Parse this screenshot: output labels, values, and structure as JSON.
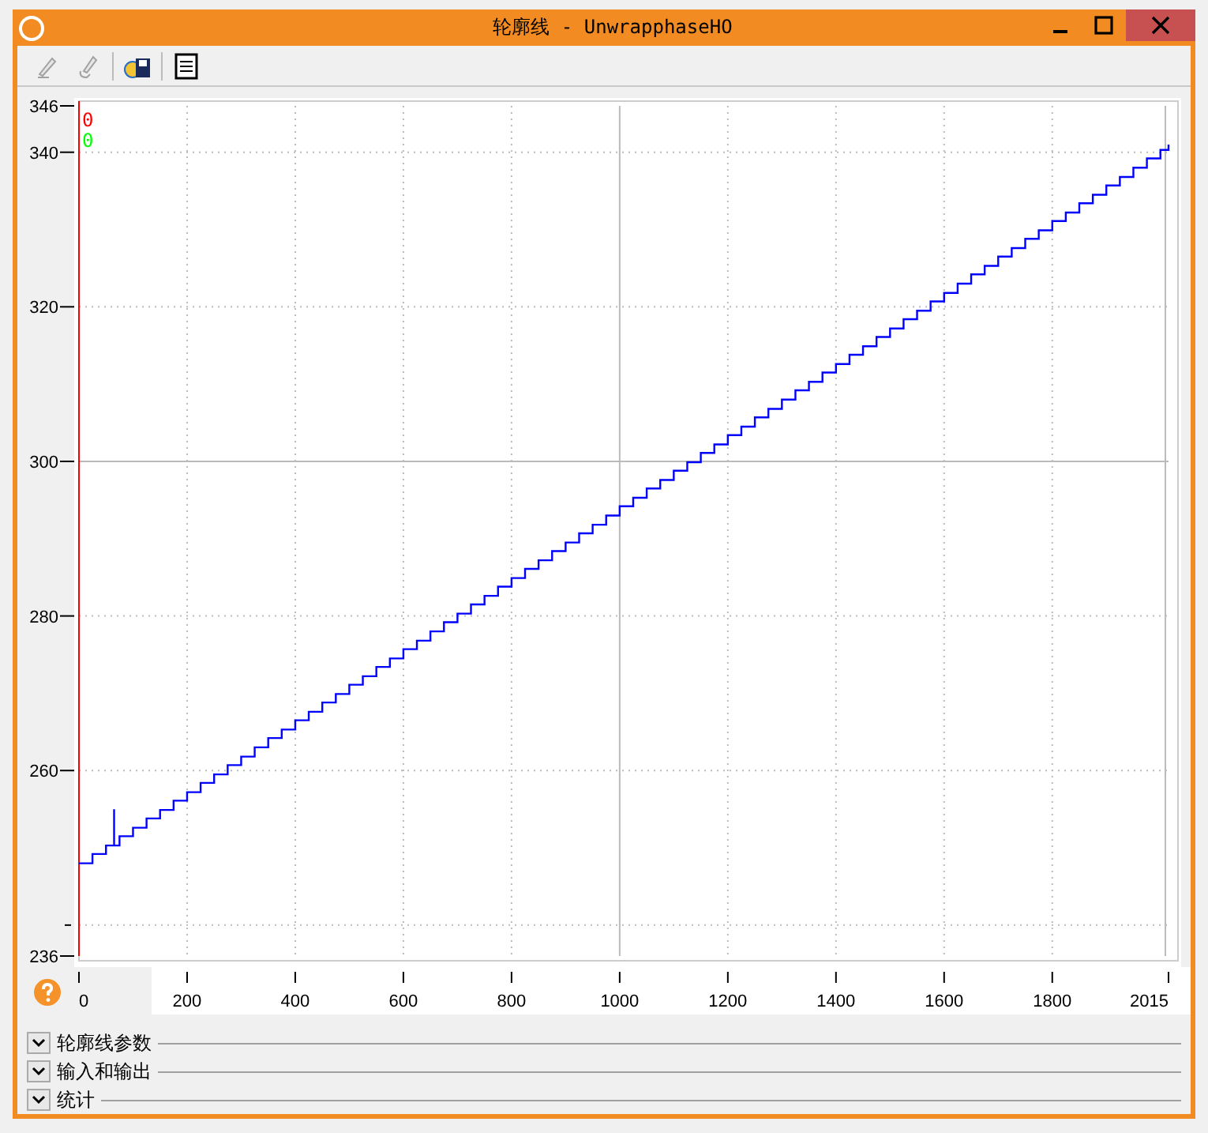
{
  "window": {
    "title": "轮廓线 - UnwrapphaseHO"
  },
  "toolbar": [
    {
      "kind": "pencil",
      "disabled": true
    },
    {
      "kind": "pencil-hand",
      "disabled": true
    },
    {
      "kind": "save"
    },
    {
      "kind": "document"
    }
  ],
  "plot": {
    "markers": [
      {
        "text": "0",
        "color": "#ff0000"
      },
      {
        "text": "0",
        "color": "#00ff00"
      }
    ],
    "chart_data": {
      "type": "line",
      "grid": true,
      "xlim": [
        0,
        2015
      ],
      "ylim": [
        236,
        346
      ],
      "xticks": [
        0,
        200,
        400,
        600,
        800,
        1000,
        1200,
        1400,
        1600,
        1800,
        2015
      ],
      "yticks": [
        236,
        260,
        280,
        300,
        320,
        340,
        346
      ],
      "series": [
        {
          "color": "#0000ff",
          "x": [
            0,
            25,
            25,
            50,
            50,
            65,
            65,
            65,
            75,
            75,
            100,
            100,
            125,
            125,
            150,
            150,
            175,
            175,
            200,
            200,
            225,
            225,
            250,
            250,
            275,
            275,
            300,
            300,
            325,
            325,
            350,
            350,
            375,
            375,
            400,
            400,
            425,
            425,
            450,
            450,
            475,
            475,
            500,
            500,
            525,
            525,
            550,
            550,
            575,
            575,
            600,
            600,
            625,
            625,
            650,
            650,
            675,
            675,
            700,
            700,
            725,
            725,
            750,
            750,
            775,
            775,
            800,
            800,
            825,
            825,
            850,
            850,
            875,
            875,
            900,
            900,
            925,
            925,
            950,
            950,
            975,
            975,
            1000,
            1000,
            1025,
            1025,
            1050,
            1050,
            1075,
            1075,
            1100,
            1100,
            1125,
            1125,
            1150,
            1150,
            1175,
            1175,
            1200,
            1200,
            1225,
            1225,
            1250,
            1250,
            1275,
            1275,
            1300,
            1300,
            1325,
            1325,
            1350,
            1350,
            1375,
            1375,
            1400,
            1400,
            1425,
            1425,
            1450,
            1450,
            1475,
            1475,
            1500,
            1500,
            1525,
            1525,
            1550,
            1550,
            1575,
            1575,
            1600,
            1600,
            1625,
            1625,
            1650,
            1650,
            1675,
            1675,
            1700,
            1700,
            1725,
            1725,
            1750,
            1750,
            1775,
            1775,
            1800,
            1800,
            1825,
            1825,
            1850,
            1850,
            1875,
            1875,
            1900,
            1900,
            1925,
            1925,
            1950,
            1950,
            1975,
            1975,
            2000,
            2000,
            2015,
            2015
          ],
          "values": [
            248,
            248,
            249.2,
            249.2,
            250.3,
            250.3,
            255,
            250.3,
            250.3,
            251.5,
            251.5,
            252.6,
            252.6,
            253.8,
            253.8,
            254.9,
            254.9,
            256.1,
            256.1,
            257.2,
            257.2,
            258.4,
            258.4,
            259.5,
            259.5,
            260.7,
            260.7,
            261.8,
            261.8,
            263,
            263,
            264.2,
            264.2,
            265.3,
            265.3,
            266.5,
            266.5,
            267.6,
            267.6,
            268.8,
            268.8,
            269.9,
            269.9,
            271.1,
            271.1,
            272.2,
            272.2,
            273.4,
            273.4,
            274.5,
            274.5,
            275.7,
            275.7,
            276.8,
            276.8,
            278,
            278,
            279.2,
            279.2,
            280.3,
            280.3,
            281.5,
            281.5,
            282.6,
            282.6,
            283.8,
            283.8,
            284.9,
            284.9,
            286.1,
            286.1,
            287.2,
            287.2,
            288.4,
            288.4,
            289.5,
            289.5,
            290.7,
            290.7,
            291.8,
            291.8,
            293,
            293,
            294.2,
            294.2,
            295.3,
            295.3,
            296.5,
            296.5,
            297.6,
            297.6,
            298.8,
            298.8,
            299.9,
            299.9,
            301.1,
            301.1,
            302.2,
            302.2,
            303.4,
            303.4,
            304.5,
            304.5,
            305.7,
            305.7,
            306.8,
            306.8,
            308,
            308,
            309.2,
            309.2,
            310.3,
            310.3,
            311.5,
            311.5,
            312.6,
            312.6,
            313.8,
            313.8,
            314.9,
            314.9,
            316.1,
            316.1,
            317.2,
            317.2,
            318.4,
            318.4,
            319.5,
            319.5,
            320.7,
            320.7,
            321.8,
            321.8,
            323,
            323,
            324.2,
            324.2,
            325.3,
            325.3,
            326.5,
            326.5,
            327.6,
            327.6,
            328.8,
            328.8,
            329.9,
            329.9,
            331.1,
            331.1,
            332.2,
            332.2,
            333.4,
            333.4,
            334.5,
            334.5,
            335.7,
            335.7,
            336.8,
            336.8,
            338,
            338,
            339.2,
            339.2,
            340.3,
            340.3,
            341
          ]
        }
      ]
    }
  },
  "sections": [
    {
      "label": "轮廓线参数",
      "expanded": false
    },
    {
      "label": "输入和输出",
      "expanded": false
    },
    {
      "label": "统计",
      "expanded": false
    }
  ]
}
